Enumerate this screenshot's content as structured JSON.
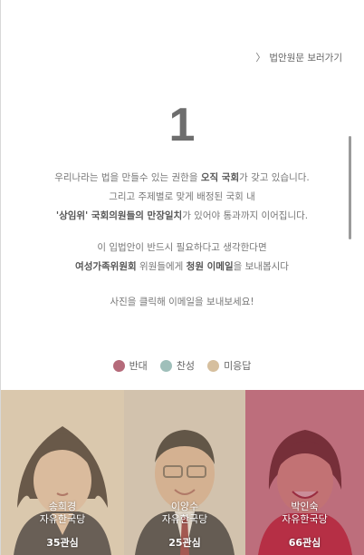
{
  "link": {
    "label": "법안원문 보러가기",
    "icon": "chevron-right-icon"
  },
  "bill_number": "1",
  "intro": {
    "line1": {
      "pre": "우리나라는 법을 만들수 있는 권한을 ",
      "bold": "오직 국회",
      "post": "가 갖고 있습니다."
    },
    "line2": "그리고 주제별로 맞게 배정된 국회 내",
    "line3": {
      "bold1": "'상임위' 국회의원들의 만장일치",
      "post": "가 있어야 통과까지 이어집니다."
    }
  },
  "appeal": {
    "line1": "이 입법안이 반드시 필요하다고 생각한다면",
    "line2": {
      "bold1": "여성가족위원회",
      "mid": " 위원들에게 ",
      "bold2": "청원 이메일",
      "post": "을 보내봅시다"
    }
  },
  "cta": "사진을 클릭해 이메일을 보내보세요!",
  "legend": [
    {
      "label": "반대",
      "color": "#b56a7a"
    },
    {
      "label": "찬성",
      "color": "#9fbfba"
    },
    {
      "label": "미응답",
      "color": "#d6bf9e"
    }
  ],
  "members": [
    {
      "name": "송희경",
      "party": "자유한국당",
      "interest": "35관심",
      "status": "미응답",
      "tint": "#c9b08c"
    },
    {
      "name": "이양수",
      "party": "자유한국당",
      "interest": "25관심",
      "status": "미응답",
      "tint": "#c9b08c"
    },
    {
      "name": "박인숙",
      "party": "자유한국당",
      "interest": "66관심",
      "status": "반대",
      "tint": "#a8384f"
    }
  ]
}
